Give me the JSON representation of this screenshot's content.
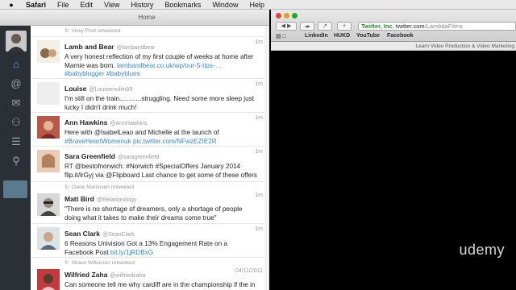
{
  "menubar": {
    "app": "Safari",
    "items": [
      "File",
      "Edit",
      "View",
      "History",
      "Bookmarks",
      "Window",
      "Help"
    ]
  },
  "twitter": {
    "window_title": "Home",
    "tweets": [
      {
        "retweeted_by": "Vicky Pont retweeted",
        "name": "",
        "handle": "",
        "time": "",
        "text": "",
        "partial": true
      },
      {
        "retweeted_by": "",
        "name": "Lamb and Bear",
        "handle": "@lambandbear",
        "time": "1m",
        "text": "A very honest reflection of my first couple of weeks at home after Marnie was born. ",
        "link": "lambandbear.co.uk/wp/our-5-tips-… #babyblogger #babyblues"
      },
      {
        "retweeted_by": "",
        "name": "Louise",
        "handle": "@Louisemullin89",
        "time": "1m",
        "text": "I'm still on the train............struggling. Need some more sleep just lucky I didn't drink much!",
        "link": ""
      },
      {
        "retweeted_by": "",
        "name": "Ann Hawkins",
        "handle": "@AnnHawkins",
        "time": "1m",
        "text": "Here with @IsabelLeao and Michelle at the launch of ",
        "link": "#BraveHeartWomenuk pic.twitter.com/NFwzEZIE2R"
      },
      {
        "retweeted_by": "",
        "name": "Sara Greenfield",
        "handle": "@saragreenfield",
        "time": "1m",
        "text": "RT @bestofnorwich: #Norwich #SpecialOffers January 2014 flip.it/lrGyj via @Flipboard Last chance to get some of these offers",
        "link": ""
      },
      {
        "retweeted_by": "Claire Martinsen retweeted",
        "name": "Matt Bird",
        "handle": "@Relationology",
        "time": "1m",
        "text": "\"There is no shortage of dreamers, only a shortage of people doing what it takes to make their dreams come true\"",
        "link": ""
      },
      {
        "retweeted_by": "",
        "name": "Sean Clark",
        "handle": "@SeanClark",
        "time": "1m",
        "text": "6 Reasons Univision Got a 13% Engagement Rate on a Facebook Post ",
        "link": "bit.ly/1jRDBxG"
      },
      {
        "retweeted_by": "Shaun Wilkinson retweeted",
        "name": "Wilfried Zaha",
        "handle": "@wilfriedzaha",
        "time": "04/11/2011",
        "text": "Can someone tell me why cardiff are in the championship if the in",
        "link": ""
      }
    ]
  },
  "safari": {
    "url_cert": "Twitter, Inc.",
    "url_host": "twitter.com",
    "url_path": "/LambdaFilms",
    "bookmarks": [
      "LinkedIn",
      "HUKD",
      "YouTube",
      "Facebook"
    ],
    "strip_text": "Learn Video Production & Video Marketing",
    "watermark": "udemy"
  },
  "colors": {
    "link": "#3b88c3",
    "sidebar": "#2b2f36",
    "active_icon": "#4db3f5"
  }
}
